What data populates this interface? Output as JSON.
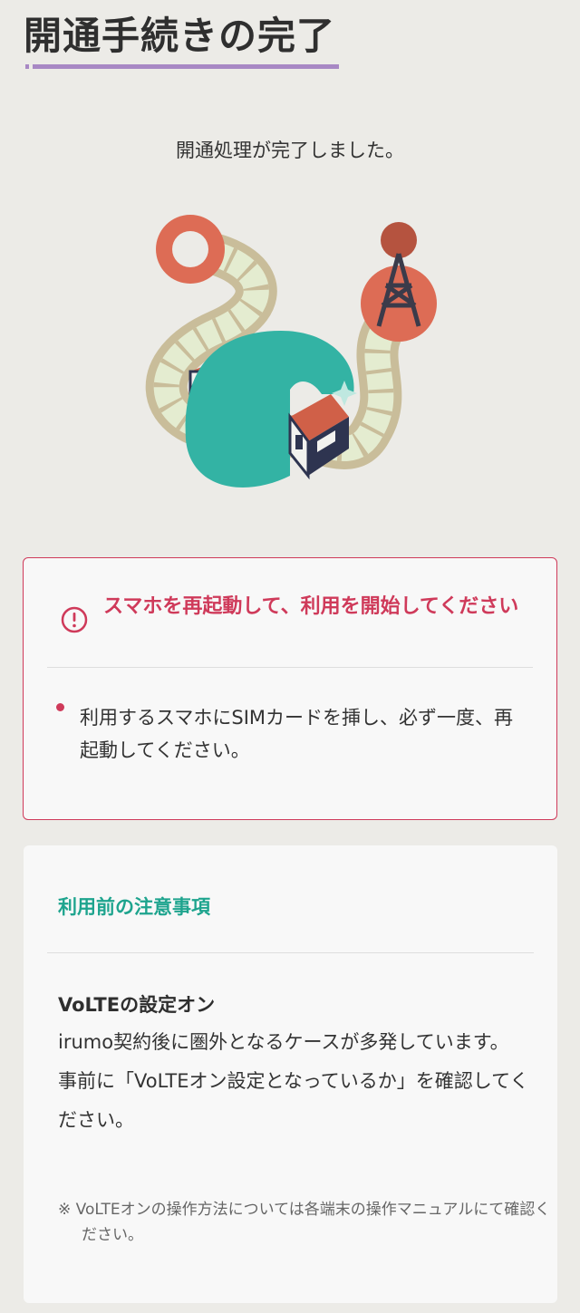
{
  "page": {
    "title": "開通手続きの完了",
    "subtitle": "開通処理が完了しました。"
  },
  "warning_card": {
    "icon": "exclamation-circle-icon",
    "title": "スマホを再起動して、利用を開始してください",
    "items": [
      "利用するスマホにSIMカードを挿し、必ず一度、再起動してください。"
    ],
    "accent_color": "#cf3a5a"
  },
  "notice_card": {
    "title": "利用前の注意事項",
    "heading": "VoLTEの設定オン",
    "body_lines": [
      "irumo契約後に圏外となるケースが多発しています。",
      "事前に「VoLTEオン設定となっているか」を確認してください。"
    ],
    "footnote": "※ VoLTEオンの操作方法については各端末の操作マニュアルにて確認ください。",
    "accent_color": "#1ea48e"
  },
  "illustration": {
    "description_icon": "train-tunnel-antenna-illustration"
  }
}
